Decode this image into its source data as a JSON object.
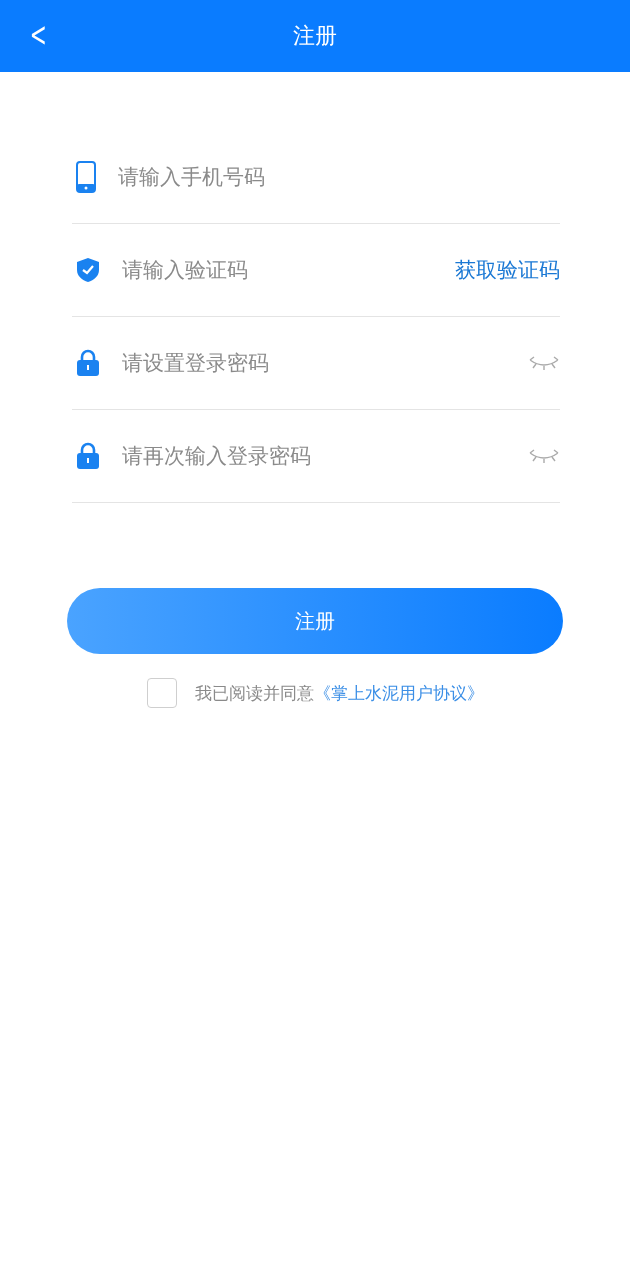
{
  "header": {
    "back": "<",
    "title": "注册"
  },
  "fields": [
    {
      "kind": "phone",
      "placeholder": "请输入手机号码",
      "trailing": {
        "kind": "none"
      }
    },
    {
      "kind": "shield",
      "placeholder": "请输入验证码",
      "trailing": {
        "kind": "code",
        "label": "获取验证码"
      }
    },
    {
      "kind": "lock",
      "placeholder": "请设置登录密码",
      "trailing": {
        "kind": "eye"
      }
    },
    {
      "kind": "lock",
      "placeholder": "请再次输入登录密码",
      "trailing": {
        "kind": "eye"
      }
    }
  ],
  "submit": "注册",
  "agreement": {
    "checked": false,
    "text": "我已阅读并同意",
    "link": "《掌上水泥用户协议》"
  }
}
